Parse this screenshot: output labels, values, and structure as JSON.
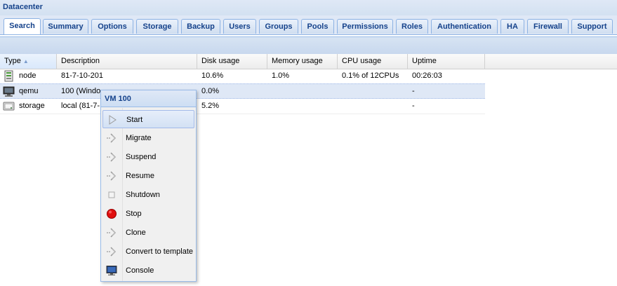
{
  "header": {
    "title": "Datacenter"
  },
  "tabs": [
    {
      "label": "Search"
    },
    {
      "label": "Summary"
    },
    {
      "label": "Options"
    },
    {
      "label": "Storage"
    },
    {
      "label": "Backup"
    },
    {
      "label": "Users"
    },
    {
      "label": "Groups"
    },
    {
      "label": "Pools"
    },
    {
      "label": "Permissions"
    },
    {
      "label": "Roles"
    },
    {
      "label": "Authentication"
    },
    {
      "label": "HA"
    },
    {
      "label": "Firewall"
    },
    {
      "label": "Support"
    }
  ],
  "active_tab": "Search",
  "grid": {
    "columns": [
      {
        "label": "Type"
      },
      {
        "label": "Description"
      },
      {
        "label": "Disk usage"
      },
      {
        "label": "Memory usage"
      },
      {
        "label": "CPU usage"
      },
      {
        "label": "Uptime"
      }
    ],
    "rows": [
      {
        "type": "node",
        "description": "81-7-10-201",
        "disk": "10.6%",
        "memory": "1.0%",
        "cpu": "0.1% of 12CPUs",
        "uptime": "00:26:03",
        "icon": "server-icon"
      },
      {
        "type": "qemu",
        "description": "100 (Windo",
        "disk": "0.0%",
        "memory": "",
        "cpu": "",
        "uptime": "-",
        "icon": "monitor-icon"
      },
      {
        "type": "storage",
        "description": "local (81-7-",
        "disk": "5.2%",
        "memory": "",
        "cpu": "",
        "uptime": "-",
        "icon": "storage-icon"
      }
    ]
  },
  "context_menu": {
    "title": "VM 100",
    "items": [
      {
        "label": "Start",
        "icon": "play-icon"
      },
      {
        "label": "Migrate",
        "icon": "migrate-icon"
      },
      {
        "label": "Suspend",
        "icon": "suspend-icon"
      },
      {
        "label": "Resume",
        "icon": "resume-icon"
      },
      {
        "label": "Shutdown",
        "icon": "shutdown-icon"
      },
      {
        "label": "Stop",
        "icon": "stop-icon"
      },
      {
        "label": "Clone",
        "icon": "clone-icon"
      },
      {
        "label": "Convert to template",
        "icon": "template-icon"
      },
      {
        "label": "Console",
        "icon": "console-icon"
      }
    ]
  },
  "colors": {
    "accent": "#15428b",
    "tab_border": "#8db2e3",
    "stop_red": "#e01010"
  }
}
